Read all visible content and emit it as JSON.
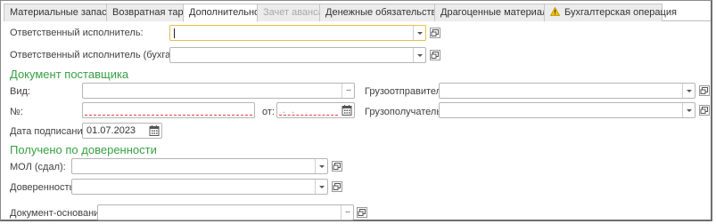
{
  "tabs": [
    {
      "label": "Материальные запасы",
      "state": "normal"
    },
    {
      "label": "Возвратная тара",
      "state": "normal"
    },
    {
      "label": "Дополнительно",
      "state": "active"
    },
    {
      "label": "Зачет аванса",
      "state": "disabled"
    },
    {
      "label": "Денежные обязательства",
      "state": "normal"
    },
    {
      "label": "Драгоценные материалы",
      "state": "normal"
    },
    {
      "label": "Бухгалтерская операция",
      "state": "normal",
      "icon": "warning-icon"
    }
  ],
  "fields": {
    "responsible": {
      "label": "Ответственный исполнитель:",
      "value": ""
    },
    "responsible_accountant": {
      "label": "Ответственный исполнитель (бухгалтер):",
      "value": ""
    }
  },
  "supplier_doc": {
    "title": "Документ поставщика",
    "type_label": "Вид:",
    "type_value": "",
    "number_label": "№:",
    "number_value": "",
    "from_label": "от:",
    "from_mask": ". .",
    "shipper_label": "Грузоотправитель:",
    "shipper_value": "",
    "consignee_label": "Грузополучатель:",
    "consignee_value": "",
    "sign_date_label": "Дата подписания:",
    "sign_date_value": "01.07.2023"
  },
  "proxy": {
    "title": "Получено по доверенности",
    "mol_label": "МОЛ (сдал):",
    "mol_value": "",
    "power_label": "Доверенность:",
    "power_value": "",
    "basis_label": "Документ-основание:",
    "basis_value": ""
  },
  "icons": {
    "dropdown": "chevron-down-icon",
    "open": "open-form-icon",
    "select": "ellipsis-icon",
    "calendar": "calendar-icon",
    "warning": "warning-icon"
  },
  "colors": {
    "section_title": "#36a043",
    "focus_border": "#e7c04a",
    "required_underline": "#e04040"
  }
}
